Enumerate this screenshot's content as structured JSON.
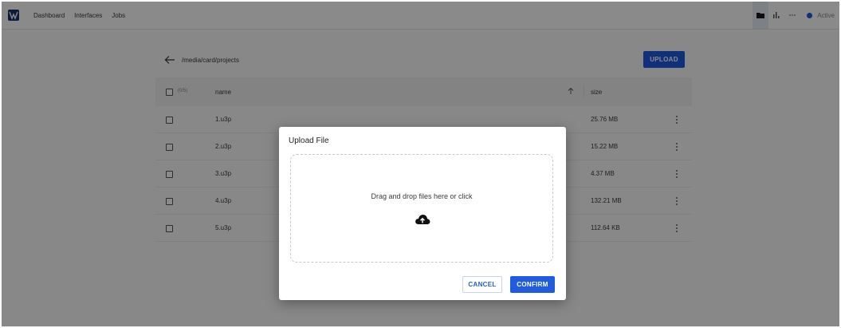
{
  "nav": {
    "items": [
      "Dashboard",
      "Interfaces",
      "Jobs"
    ],
    "status": "Active",
    "status_color": "#1f5ce0",
    "icons": [
      "logo-icon",
      "folder-icon",
      "chart-icon",
      "more-icon"
    ]
  },
  "browser": {
    "path": "/media/card/projects",
    "upload_label": "UPLOAD",
    "header": {
      "count": "(0/5)",
      "name": "name",
      "size": "size"
    },
    "rows": [
      {
        "name": "1.u3p",
        "size": "25.76 MB"
      },
      {
        "name": "2.u3p",
        "size": "15.22 MB"
      },
      {
        "name": "3.u3p",
        "size": "4.37 MB"
      },
      {
        "name": "4.u3p",
        "size": "132.21 MB"
      },
      {
        "name": "5.u3p",
        "size": "112.64 KB"
      }
    ]
  },
  "dialog": {
    "title": "Upload File",
    "dropzone_text": "Drag and drop files here or click",
    "cancel_label": "CANCEL",
    "confirm_label": "CONFIRM"
  },
  "colors": {
    "accent": "#1f5ce0",
    "logo": "#15336b"
  }
}
